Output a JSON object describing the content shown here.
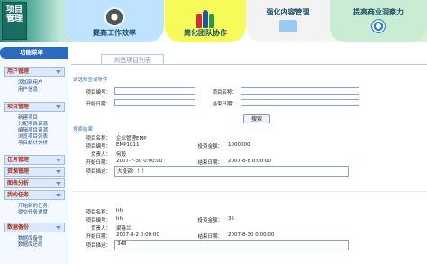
{
  "banner": {
    "logo": "项目管理",
    "items": [
      {
        "label": "提高工作效率",
        "icon": "gear-icon"
      },
      {
        "label": "简化团队协作",
        "icon": "people-icon"
      },
      {
        "label": "强化内容管理",
        "icon": "folder-icon"
      },
      {
        "label": "提高商业洞察力",
        "icon": "target-icon"
      }
    ]
  },
  "sidebar": {
    "header": "功能菜单",
    "sections": [
      {
        "title": "用户管理",
        "items": [
          "添加新用户",
          "用户信息"
        ]
      },
      {
        "title": "项目管理",
        "items": [
          "新建项目",
          "分配项目资源",
          "编辑项目资源",
          "浏览项目列表",
          "项目统计分析"
        ]
      },
      {
        "title": "任务管理",
        "items": []
      },
      {
        "title": "资源管理",
        "items": []
      },
      {
        "title": "图表分析",
        "items": []
      },
      {
        "title": "我的任务",
        "items": [
          "开始新的任务",
          "提交任务进度"
        ]
      },
      {
        "title": "数据备份",
        "items": [
          "数据库备份",
          "数据库还原"
        ]
      }
    ]
  },
  "main": {
    "title": "浏览项目列表",
    "filter": {
      "group_label": "请选择查询条件",
      "project_no_label": "项目编号：",
      "project_name_label": "项目名称：",
      "start_date_label": "开始日期：",
      "end_date_label": "结束日期：",
      "project_no_value": "",
      "project_name_value": "",
      "start_date_value": "",
      "end_date_value": "",
      "search_button": "搜索"
    },
    "results": {
      "group_label": "搜索结果",
      "field_labels": {
        "name": "项目名称：",
        "no": "项目编号：",
        "amount": "投资金额：",
        "owner": "负责人：",
        "start": "开始日期：",
        "end": "结束日期：",
        "desc": "项目描述："
      },
      "items": [
        {
          "name": "企业管理EMP",
          "no": "EMP1011",
          "amount": "1000000",
          "owner": "何毅",
          "start": "2007-7-30 0:00:00",
          "end": "2007-8-8 0:00:00",
          "desc": "大投资！！！"
        },
        {
          "name": "hh",
          "no": "hh",
          "amount": "35",
          "owner": "梁春兰",
          "start": "2007-8-2 0:00:00",
          "end": "2007-8-30 0:00:00",
          "desc": "348"
        }
      ]
    }
  }
}
